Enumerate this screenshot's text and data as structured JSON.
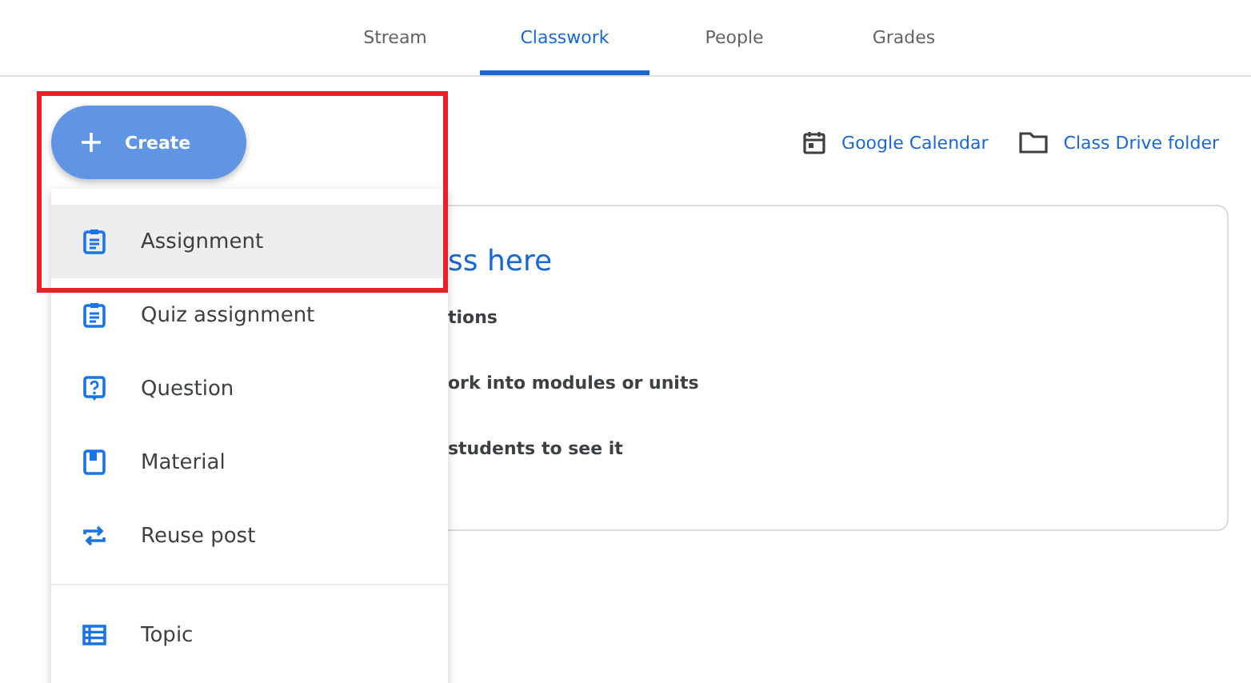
{
  "tabs": [
    {
      "label": "Stream",
      "selected": false
    },
    {
      "label": "Classwork",
      "selected": true
    },
    {
      "label": "People",
      "selected": false
    },
    {
      "label": "Grades",
      "selected": false
    }
  ],
  "create_button": {
    "label": "Create"
  },
  "links": [
    {
      "kind": "calendar",
      "label": "Google Calendar"
    },
    {
      "kind": "folder",
      "label": "Class Drive folder"
    }
  ],
  "card": {
    "title": "ss here",
    "lines": [
      "tions",
      "ork into modules or units",
      "students to see it"
    ]
  },
  "menu": {
    "items": [
      {
        "kind": "assignment",
        "label": "Assignment",
        "selected": true
      },
      {
        "kind": "quiz",
        "label": "Quiz assignment",
        "selected": false
      },
      {
        "kind": "question",
        "label": "Question",
        "selected": false
      },
      {
        "kind": "material",
        "label": "Material",
        "selected": false
      },
      {
        "kind": "reuse",
        "label": "Reuse post",
        "selected": false
      },
      {
        "kind": "topic",
        "label": "Topic",
        "selected": false
      }
    ]
  }
}
